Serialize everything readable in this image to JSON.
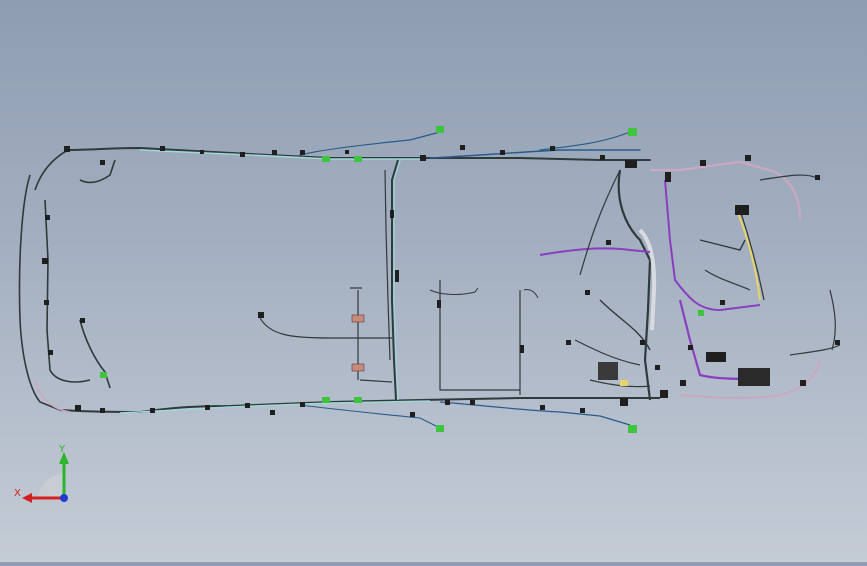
{
  "viewport": {
    "background_top": "#8e9db1",
    "background_bottom": "#c5ccd6"
  },
  "colors": {
    "harness_main": "#2f3a3a",
    "harness_cyan": "#9ed7d6",
    "harness_purple": "#8a3fc1",
    "harness_pink": "#caa8c0",
    "harness_blue": "#2b5a8a",
    "harness_yellow": "#e8d36a",
    "connector_dark": "#1f1f1f",
    "connector_green": "#3ec43e",
    "connector_red": "#c98a7e",
    "axis_x": "#d42020",
    "axis_y": "#2bb52b",
    "axis_z": "#1f3bd1"
  },
  "triad": {
    "x_label": "X",
    "y_label": "Y"
  }
}
